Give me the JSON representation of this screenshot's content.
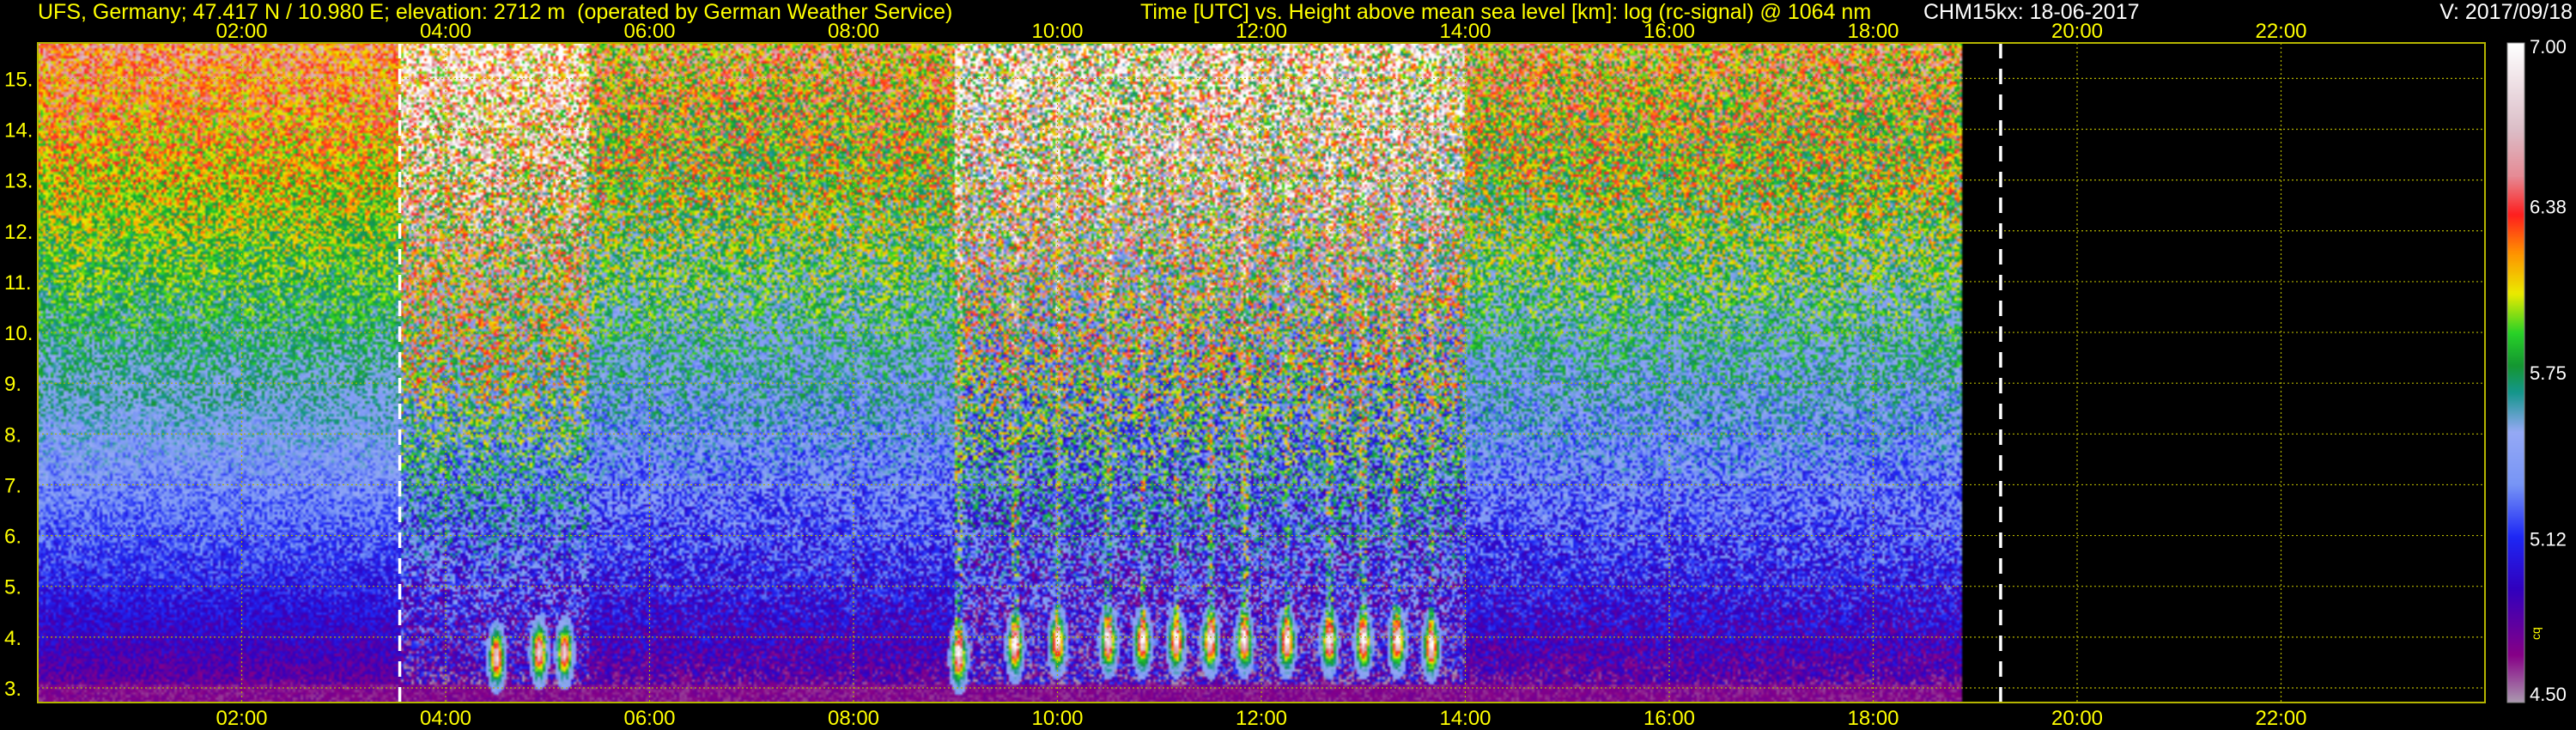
{
  "header": {
    "site": "UFS, Germany; 47.417 N / 10.980 E; elevation: 2712 m  (operated by German Weather Service)",
    "axes_title": "Time [UTC] vs. Height above mean sea level [km]: log (rc-signal) @ 1064 nm",
    "instrument_date": "CHM15kx: 18-06-2017",
    "version": "V: 2017/09/18"
  },
  "colors": {
    "background": "#000000",
    "labels": "#ffff00",
    "grid": "#b4b400",
    "marker_lines": "#ffffff"
  },
  "chart_data": {
    "type": "heatmap",
    "xlabel": "Time [UTC]",
    "ylabel": "Height above mean sea level [km]",
    "xlim": [
      "00:00",
      "24:00"
    ],
    "x_ticks": [
      "02:00",
      "04:00",
      "06:00",
      "08:00",
      "10:00",
      "12:00",
      "14:00",
      "16:00",
      "18:00",
      "20:00",
      "22:00"
    ],
    "ylim": [
      2.712,
      15.7
    ],
    "y_ticks": [
      "3.",
      "4.",
      "5.",
      "6.",
      "7.",
      "8.",
      "9.",
      "10.",
      "11.",
      "12.",
      "13.",
      "14.",
      "15."
    ],
    "grid": true,
    "data_end": "18:53",
    "dashed_markers": [
      "03:33",
      "19:15"
    ],
    "colorbar": {
      "min": 4.5,
      "max": 7.0,
      "ticks": [
        "4.50",
        "5.12",
        "5.75",
        "6.38",
        "7.00"
      ],
      "label": "cq"
    },
    "regions": [
      {
        "start": "00:00",
        "end": "03:33",
        "signal": "low-noise"
      },
      {
        "start": "03:33",
        "end": "05:25",
        "signal": "noisy"
      },
      {
        "start": "05:25",
        "end": "09:00",
        "signal": "clear"
      },
      {
        "start": "09:00",
        "end": "14:00",
        "signal": "clouds-and-noise"
      },
      {
        "start": "14:00",
        "end": "18:53",
        "signal": "clear"
      }
    ],
    "cloud_events": [
      {
        "time": "04:30",
        "height_km": 3.6
      },
      {
        "time": "04:55",
        "height_km": 3.7
      },
      {
        "time": "05:10",
        "height_km": 3.7
      },
      {
        "time": "09:02",
        "height_km": 3.6
      },
      {
        "time": "09:35",
        "height_km": 3.8
      },
      {
        "time": "10:00",
        "height_km": 3.9
      },
      {
        "time": "10:30",
        "height_km": 3.9
      },
      {
        "time": "10:50",
        "height_km": 3.9
      },
      {
        "time": "11:10",
        "height_km": 3.9
      },
      {
        "time": "11:30",
        "height_km": 3.9
      },
      {
        "time": "11:50",
        "height_km": 3.9
      },
      {
        "time": "12:15",
        "height_km": 3.9
      },
      {
        "time": "12:40",
        "height_km": 3.9
      },
      {
        "time": "13:00",
        "height_km": 3.9
      },
      {
        "time": "13:20",
        "height_km": 3.9
      },
      {
        "time": "13:40",
        "height_km": 3.8
      }
    ]
  }
}
